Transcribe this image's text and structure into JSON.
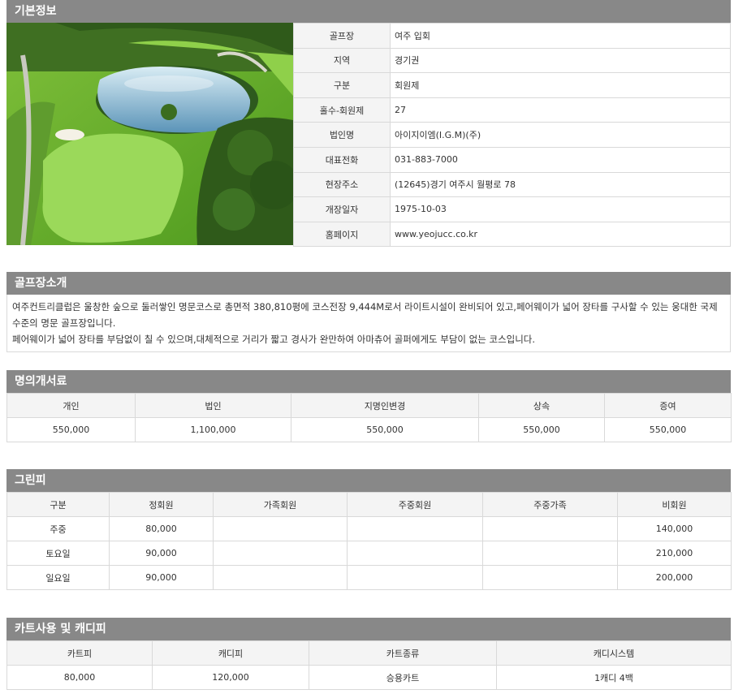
{
  "basic": {
    "title": "기본정보",
    "rows": [
      {
        "label": "골프장",
        "value": "여주 입회"
      },
      {
        "label": "지역",
        "value": "경기권"
      },
      {
        "label": "구분",
        "value": "회원제"
      },
      {
        "label": "홀수-회원제",
        "value": "27"
      },
      {
        "label": "법인명",
        "value": "아이지이엠(I.G.M)(주)"
      },
      {
        "label": "대표전화",
        "value": "031-883-7000"
      },
      {
        "label": "현장주소",
        "value": "(12645)경기 여주시 월평로 78"
      },
      {
        "label": "개장일자",
        "value": "1975-10-03"
      },
      {
        "label": "홈페이지",
        "value": "www.yeojucc.co.kr"
      }
    ]
  },
  "intro": {
    "title": "골프장소개",
    "lines": [
      "여주컨트리클럽은 울창한 숲으로 둘러쌓인 명문코스로 총면적 380,810평에 코스전장 9,444M로서 라이트시설이 완비되어 있고,페어웨이가 넓어 장타를 구사할 수 있는 웅대한 국제수준의 명문 골프장입니다.",
      "페어웨이가 넓어 장타를 부담없이 칠 수 있으며,대체적으로 거리가 짧고 경사가 완만하여 아마츄어 골퍼에게도 부담이 없는 코스입니다."
    ]
  },
  "transfer": {
    "title": "명의개서료",
    "headers": [
      "개인",
      "법인",
      "지명인변경",
      "상속",
      "증여"
    ],
    "values": [
      "550,000",
      "1,100,000",
      "550,000",
      "550,000",
      "550,000"
    ]
  },
  "greenfee": {
    "title": "그린피",
    "headers": [
      "구분",
      "정회원",
      "가족회원",
      "주중회원",
      "주중가족",
      "비회원"
    ],
    "rows": [
      [
        "주중",
        "80,000",
        "",
        "",
        "",
        "140,000"
      ],
      [
        "토요일",
        "90,000",
        "",
        "",
        "",
        "210,000"
      ],
      [
        "일요일",
        "90,000",
        "",
        "",
        "",
        "200,000"
      ]
    ]
  },
  "cart": {
    "title": "카트사용 및 캐디피",
    "headers": [
      "카트피",
      "캐디피",
      "카트종류",
      "캐디시스템"
    ],
    "values": [
      "80,000",
      "120,000",
      "승용카트",
      "1캐디 4백"
    ]
  }
}
